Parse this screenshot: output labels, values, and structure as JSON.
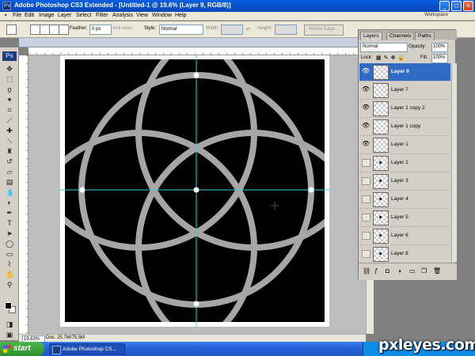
{
  "window": {
    "title": "Adobe Photoshop CS3 Extended - [Untitled-1 @ 19.6% (Layer 9, RGB/8)]",
    "controls": [
      "minimize",
      "maximize",
      "close"
    ]
  },
  "menu": [
    "File",
    "Edit",
    "Image",
    "Layer",
    "Select",
    "Filter",
    "Analysis",
    "View",
    "Window",
    "Help"
  ],
  "workspace_label": "Workspace",
  "options": {
    "feather_label": "Feather:",
    "feather_value": "0 px",
    "antialias_label": "Anti-alias",
    "style_label": "Style:",
    "style_value": "Normal",
    "width_label": "Width:",
    "height_label": "Height:",
    "refine_edge": "Refine Edge..."
  },
  "tools": {
    "logo": "Ps",
    "icons": [
      "move-icon",
      "marquee-icon",
      "lasso-icon",
      "magic-wand-icon",
      "crop-icon",
      "slice-icon",
      "healing-icon",
      "brush-icon",
      "stamp-icon",
      "history-brush-icon",
      "eraser-icon",
      "gradient-icon",
      "blur-icon",
      "dodge-icon",
      "pen-icon",
      "type-icon",
      "path-select-icon",
      "shape-icon",
      "notes-icon",
      "eyedropper-icon",
      "hand-icon",
      "zoom-icon"
    ],
    "foreground": "#000000",
    "background": "#ffffff"
  },
  "document": {
    "zoom": "19.63%",
    "doc_info": "Doc: 25.7M/75.5M",
    "canvas_bg": "#ffffff",
    "art_bg": "#000000",
    "ring_color": "#a6a6a6",
    "guide_color": "#35d0e0"
  },
  "layers_panel": {
    "tabs": [
      "Layers",
      "Channels",
      "Paths"
    ],
    "blend_mode": "Normal",
    "opacity_label": "Opacity:",
    "opacity_value": "100%",
    "lock_label": "Lock:",
    "fill_label": "Fill:",
    "fill_value": "100%",
    "layers": [
      {
        "name": "Layer 9",
        "visible": true,
        "selected": true,
        "dot": false
      },
      {
        "name": "Layer 7",
        "visible": true,
        "selected": false,
        "dot": false
      },
      {
        "name": "Layer 1 copy 2",
        "visible": true,
        "selected": false,
        "dot": false
      },
      {
        "name": "Layer 1 copy",
        "visible": true,
        "selected": false,
        "dot": false
      },
      {
        "name": "Layer 1",
        "visible": true,
        "selected": false,
        "dot": false
      },
      {
        "name": "Layer 2",
        "visible": false,
        "selected": false,
        "dot": true
      },
      {
        "name": "Layer 3",
        "visible": false,
        "selected": false,
        "dot": true
      },
      {
        "name": "Layer 4",
        "visible": false,
        "selected": false,
        "dot": true
      },
      {
        "name": "Layer 5",
        "visible": false,
        "selected": false,
        "dot": true
      },
      {
        "name": "Layer 6",
        "visible": false,
        "selected": false,
        "dot": true
      },
      {
        "name": "Layer 8",
        "visible": false,
        "selected": false,
        "dot": true
      }
    ]
  },
  "taskbar": {
    "start": "start",
    "task": "Adobe Photoshop CS...",
    "watermark": "pxleyes.com"
  }
}
